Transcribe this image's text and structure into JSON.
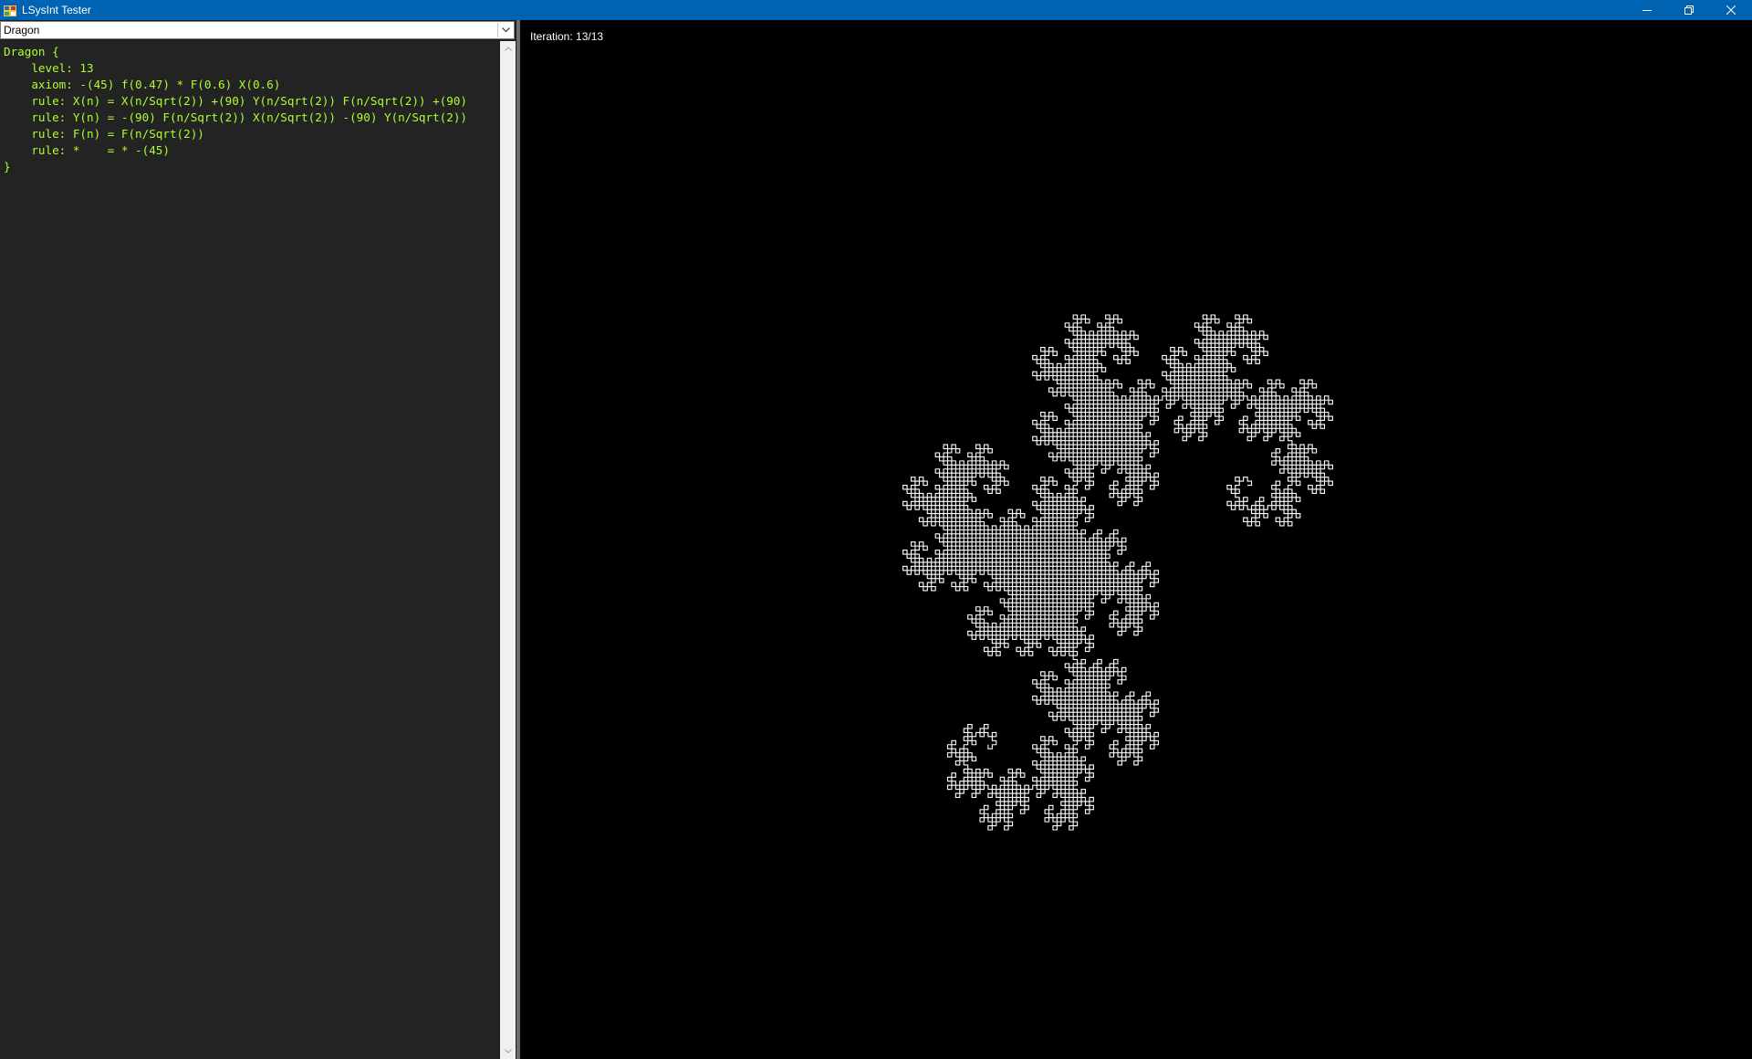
{
  "window": {
    "title": "LSysInt Tester"
  },
  "editor": {
    "selected_system": "Dragon",
    "code_lines": [
      "Dragon {",
      "    level: 13",
      "    axiom: -(45) f(0.47) * F(0.6) X(0.6)",
      "    rule: X(n) = X(n/Sqrt(2)) +(90) Y(n/Sqrt(2)) F(n/Sqrt(2)) +(90)",
      "    rule: Y(n) = -(90) F(n/Sqrt(2)) X(n/Sqrt(2)) -(90) Y(n/Sqrt(2))",
      "    rule: F(n) = F(n/Sqrt(2))",
      "    rule: *    = * -(45)",
      "}"
    ],
    "code_color": "#adff2f"
  },
  "viewer": {
    "iteration_label": "Iteration: 13/13",
    "line_color": "#ffffff",
    "background_color": "#000000",
    "fractal_type": "dragon-curve",
    "iterations": 13
  },
  "icons": {
    "app": "app-icon",
    "minimize": "minimize-icon",
    "restore": "restore-icon",
    "close": "close-icon",
    "dropdown": "chevron-down-icon"
  }
}
